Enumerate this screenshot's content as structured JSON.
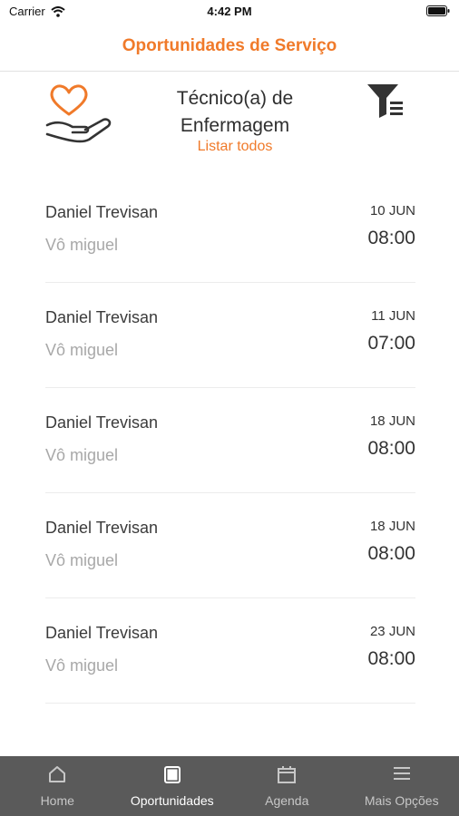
{
  "status_bar": {
    "carrier": "Carrier",
    "time": "4:42 PM"
  },
  "header": {
    "title": "Oportunidades de Serviço"
  },
  "category": {
    "title_line1": "Técnico(a) de",
    "title_line2": "Enfermagem",
    "list_all": "Listar todos",
    "icon": "heart-hand-icon",
    "filter_icon": "filter-icon"
  },
  "opportunities": [
    {
      "name": "Daniel Trevisan",
      "location": "Vô miguel",
      "date": "10 JUN",
      "time": "08:00"
    },
    {
      "name": "Daniel Trevisan",
      "location": "Vô miguel",
      "date": "11 JUN",
      "time": "07:00"
    },
    {
      "name": "Daniel Trevisan",
      "location": "Vô miguel",
      "date": "18 JUN",
      "time": "08:00"
    },
    {
      "name": "Daniel Trevisan",
      "location": "Vô miguel",
      "date": "18 JUN",
      "time": "08:00"
    },
    {
      "name": "Daniel Trevisan",
      "location": "Vô miguel",
      "date": "23 JUN",
      "time": "08:00"
    }
  ],
  "tabs": [
    {
      "label": "Home",
      "icon": "home-icon",
      "active": false
    },
    {
      "label": "Oportunidades",
      "icon": "tablet-icon",
      "active": true
    },
    {
      "label": "Agenda",
      "icon": "calendar-icon",
      "active": false
    },
    {
      "label": "Mais Opções",
      "icon": "menu-icon",
      "active": false
    }
  ],
  "colors": {
    "accent": "#f07a2a",
    "tab_bar": "#5a5a5a"
  }
}
